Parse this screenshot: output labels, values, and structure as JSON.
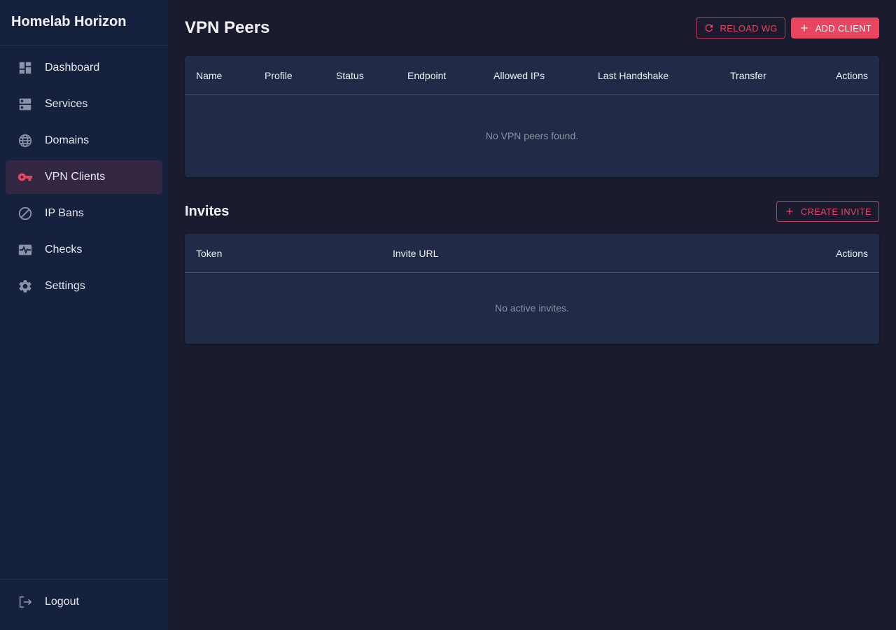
{
  "brand": "Homelab Horizon",
  "nav": {
    "items": [
      {
        "label": "Dashboard",
        "icon": "dashboard-icon"
      },
      {
        "label": "Services",
        "icon": "dns-server-icon"
      },
      {
        "label": "Domains",
        "icon": "globe-icon"
      },
      {
        "label": "VPN Clients",
        "icon": "key-icon",
        "active": true
      },
      {
        "label": "IP Bans",
        "icon": "block-icon"
      },
      {
        "label": "Checks",
        "icon": "monitor-heart-icon"
      },
      {
        "label": "Settings",
        "icon": "gear-icon"
      }
    ],
    "logout": {
      "label": "Logout",
      "icon": "logout-icon"
    }
  },
  "peers": {
    "title": "VPN Peers",
    "reload_label": "RELOAD WG",
    "add_label": "ADD CLIENT",
    "columns": [
      "Name",
      "Profile",
      "Status",
      "Endpoint",
      "Allowed IPs",
      "Last Handshake",
      "Transfer",
      "Actions"
    ],
    "empty_text": "No VPN peers found."
  },
  "invites": {
    "title": "Invites",
    "create_label": "CREATE INVITE",
    "columns": [
      "Token",
      "Invite URL",
      "Actions"
    ],
    "empty_text": "No active invites."
  },
  "colors": {
    "accent": "#e94560",
    "sidebar_bg": "#16213e",
    "page_bg": "#1a1b2e",
    "card_bg": "#212b48",
    "active_item_bg": "#332744"
  }
}
